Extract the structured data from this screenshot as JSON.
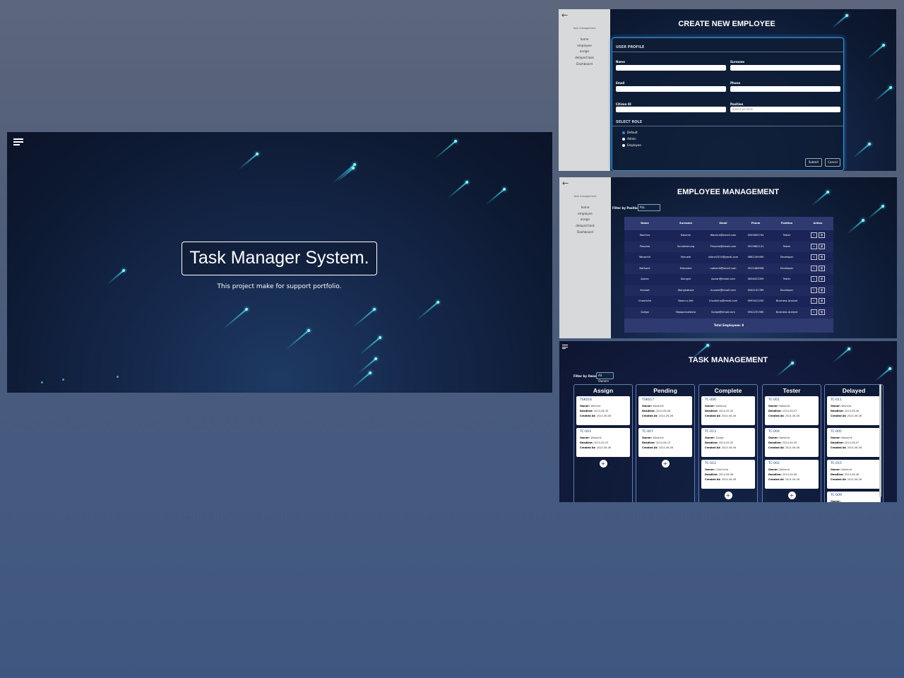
{
  "hero": {
    "title": "Task Manager System.",
    "subtitle": "This project make for support portfolio."
  },
  "sidebar": {
    "back_icon": "arrow-left-icon",
    "brand": "Task management",
    "items": [
      "home",
      "employee",
      "assign",
      "delayed task",
      "Dashboard"
    ]
  },
  "create_employee": {
    "title": "CREATE NEW EMPLOYEE",
    "section_profile": "USER PROFILE",
    "labels": {
      "name": "Name",
      "surname": "Surname",
      "email": "Email",
      "phone": "Phone",
      "citizen_id": "Citizen ID",
      "position": "Position"
    },
    "position_placeholder": "Select position",
    "section_role": "SELECT ROLE",
    "roles": [
      "Default",
      "Admin",
      "Employee"
    ],
    "selected_role": "Default",
    "submit_label": "Submit",
    "cancel_label": "Cancel"
  },
  "employee_management": {
    "title": "EMPLOYEE MANAGEMENT",
    "filter_label": "Filter by Position:",
    "filter_value": "ALL",
    "columns": [
      "Name",
      "Surname",
      "Email",
      "Phone",
      "Position",
      "Action"
    ],
    "rows": [
      [
        "Wachira",
        "Kaisiree",
        "Wachira@email.com",
        "0945690744",
        "Tester"
      ],
      [
        "Pimphia",
        "Sumeteerung",
        "Pimphia@email.com",
        "0915661131",
        "Tester"
      ],
      [
        "Worachit",
        "Naruele",
        "nilane2314@gmail.com",
        "0861249490",
        "Developer"
      ],
      [
        "Natkanit",
        "Kilanatee",
        "natkanit@email.com",
        "0912486998",
        "Developer"
      ],
      [
        "Apiran",
        "Klangsri",
        "Apiran@email.com",
        "0856023399",
        "Tester"
      ],
      [
        "Anuwat",
        "Wangkahant",
        "Anuwat@email.com",
        "0942131789",
        "Developer"
      ],
      [
        "Chonticha",
        "Boom-u-thit",
        "Chonticha@email.com",
        "0993412200",
        "Business Analyst"
      ],
      [
        "Soriga",
        "Nipapornattana",
        "Soriga@email.com",
        "0942231560",
        "Business Analyst"
      ]
    ],
    "total_label": "Total Employees: 8"
  },
  "task_management": {
    "title": "TASK MANAGEMENT",
    "filter_label": "Filter by Owner:",
    "filter_value": "All Owners",
    "owner_label": "Owner:",
    "deadline_label": "Deadline:",
    "created_label": "Created At:",
    "columns": [
      {
        "name": "Assign",
        "cards": [
          {
            "id": "TSK016",
            "owner": "Wachira",
            "deadline": "2024-06-30",
            "created": "2024-06-06"
          },
          {
            "id": "TC-003",
            "owner": "Worachit",
            "deadline": "2024-05-03",
            "created": "2024-06-06"
          }
        ],
        "add": true
      },
      {
        "name": "Pending",
        "cards": [
          {
            "id": "TSK017",
            "owner": "Worachit",
            "deadline": "2024-06-08",
            "created": "2024-06-06"
          },
          {
            "id": "TC-007",
            "owner": "Worachit",
            "deadline": "2024-06-13",
            "created": "2024-06-06"
          }
        ],
        "add": true
      },
      {
        "name": "Complete",
        "cards": [
          {
            "id": "TC-006",
            "owner": "Natkanit",
            "deadline": "2024-05-03",
            "created": "2024-06-06"
          },
          {
            "id": "TC-013",
            "owner": "Soriga",
            "deadline": "2024-05-05",
            "created": "2024-06-06"
          },
          {
            "id": "TC-012",
            "owner": "Chonticha",
            "deadline": "2024-06-06",
            "created": "2024-06-06"
          }
        ],
        "add": true
      },
      {
        "name": "Tester",
        "cards": [
          {
            "id": "TC-001",
            "owner": "Natkanit",
            "deadline": "2024-06-07",
            "created": "2024-06-06"
          },
          {
            "id": "TC-004",
            "owner": "Natkanit",
            "deadline": "2024-06-05",
            "created": "2024-06-06"
          },
          {
            "id": "TC-002",
            "owner": "Natkanit",
            "deadline": "2024-06-08",
            "created": "2024-06-06"
          }
        ],
        "add": true
      },
      {
        "name": "Delayed",
        "cards": [
          {
            "id": "TC-011",
            "owner": "Wachira",
            "deadline": "2024-06-06",
            "created": "2024-06-06"
          },
          {
            "id": "TC-005",
            "owner": "Worachit",
            "deadline": "2024-06-07",
            "created": "2024-06-06"
          },
          {
            "id": "TC-015",
            "owner": "Natkanit",
            "deadline": "2024-06-08",
            "created": "2024-06-06"
          },
          {
            "id": "TC-009",
            "owner": "",
            "deadline": "",
            "created": ""
          }
        ],
        "add": false
      }
    ]
  }
}
